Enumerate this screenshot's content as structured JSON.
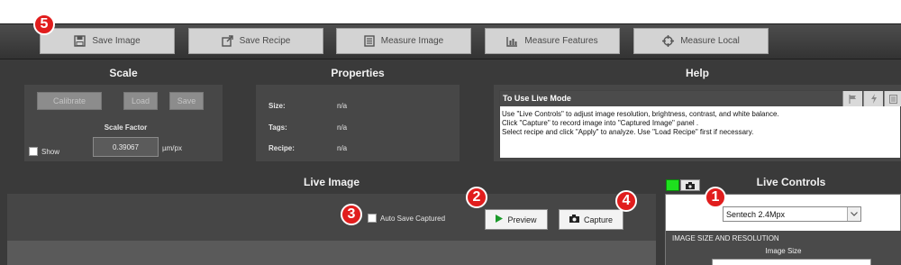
{
  "toolbar": {
    "buttons": [
      {
        "label": "Save Image",
        "icon": "floppy-disk-icon"
      },
      {
        "label": "Save Recipe",
        "icon": "export-icon"
      },
      {
        "label": "Measure Image",
        "icon": "document-icon"
      },
      {
        "label": "Measure Features",
        "icon": "bar-chart-icon"
      },
      {
        "label": "Measure Local",
        "icon": "crosshair-icon"
      }
    ]
  },
  "scale": {
    "title": "Scale",
    "calibrate": "Calibrate",
    "load": "Load",
    "save": "Save",
    "factor_label": "Scale Factor",
    "factor_value": "0.39067",
    "unit": "µm/px",
    "show_label": "Show"
  },
  "properties": {
    "title": "Properties",
    "rows": [
      {
        "label": "Size:",
        "value": "n/a"
      },
      {
        "label": "Tags:",
        "value": "n/a"
      },
      {
        "label": "Recipe:",
        "value": "n/a"
      }
    ]
  },
  "help": {
    "title": "Help",
    "subject": "To Use Live Mode",
    "lines": [
      "Use \"Live Controls\" to adjust image resolution, brightness, contrast, and white balance.",
      "Click \"Capture\" to record image into \"Captured Image\" panel .",
      "Select recipe and click \"Apply\" to analyze. Use \"Load Recipe\" first if necessary."
    ]
  },
  "live_image": {
    "title": "Live Image",
    "auto_save_label": "Auto Save Captured",
    "preview": "Preview",
    "capture": "Capture"
  },
  "live_controls": {
    "title": "Live Controls",
    "camera": "Sentech 2.4Mpx",
    "section": "IMAGE SIZE AND RESOLUTION",
    "image_size_label": "Image Size",
    "status_color": "#1ee01e"
  },
  "badges": [
    "1",
    "2",
    "3",
    "4",
    "5"
  ]
}
